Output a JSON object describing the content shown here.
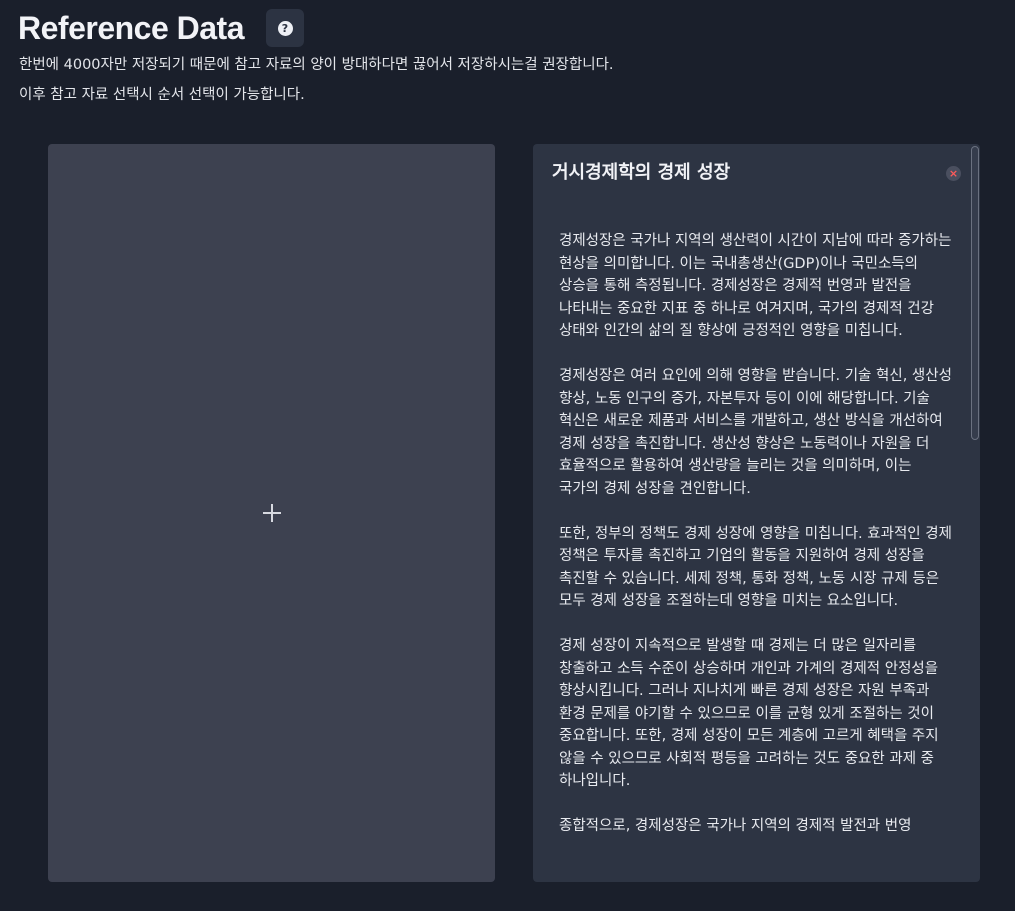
{
  "header": {
    "title": "Reference Data",
    "help_icon": "?",
    "descriptions": [
      "한번에 4000자만 저장되기 때문에 참고 자료의 양이 방대하다면 끊어서 저장하시는걸 권장합니다.",
      "이후 참고 자료 선택시 순서 선택이 가능합니다."
    ]
  },
  "add_card": {
    "icon": "plus-icon"
  },
  "reference": {
    "title": "거시경제학의 경제 성장",
    "close_icon": "×",
    "paragraphs": [
      "경제성장은 국가나 지역의 생산력이 시간이 지남에 따라 증가하는 현상을 의미합니다. 이는 국내총생산(GDP)이나 국민소득의 상승을 통해 측정됩니다. 경제성장은 경제적 번영과 발전을 나타내는 중요한 지표 중 하나로 여겨지며, 국가의 경제적 건강 상태와 인간의 삶의 질 향상에 긍정적인 영향을 미칩니다.",
      "경제성장은 여러 요인에 의해 영향을 받습니다. 기술 혁신, 생산성 향상, 노동 인구의 증가, 자본투자 등이 이에 해당합니다. 기술 혁신은 새로운 제품과 서비스를 개발하고, 생산 방식을 개선하여 경제 성장을 촉진합니다. 생산성 향상은 노동력이나 자원을 더 효율적으로 활용하여 생산량을 늘리는 것을 의미하며, 이는 국가의 경제 성장을 견인합니다.",
      "또한, 정부의 정책도 경제 성장에 영향을 미칩니다. 효과적인 경제 정책은 투자를 촉진하고 기업의 활동을 지원하여 경제 성장을 촉진할 수 있습니다. 세제 정책, 통화 정책, 노동 시장 규제 등은 모두 경제 성장을 조절하는데 영향을 미치는 요소입니다.",
      "경제 성장이 지속적으로 발생할 때 경제는 더 많은 일자리를 창출하고 소득 수준이 상승하며 개인과 가계의 경제적 안정성을 향상시킵니다. 그러나 지나치게 빠른 경제 성장은 자원 부족과 환경 문제를 야기할 수 있으므로 이를 균형 있게 조절하는 것이 중요합니다. 또한, 경제 성장이 모든 계층에 고르게 혜택을 주지 않을 수 있으므로 사회적 평등을 고려하는 것도 중요한 과제 중 하나입니다.",
      "종합적으로, 경제성장은 국가나 지역의 경제적 발전과 번영"
    ]
  }
}
